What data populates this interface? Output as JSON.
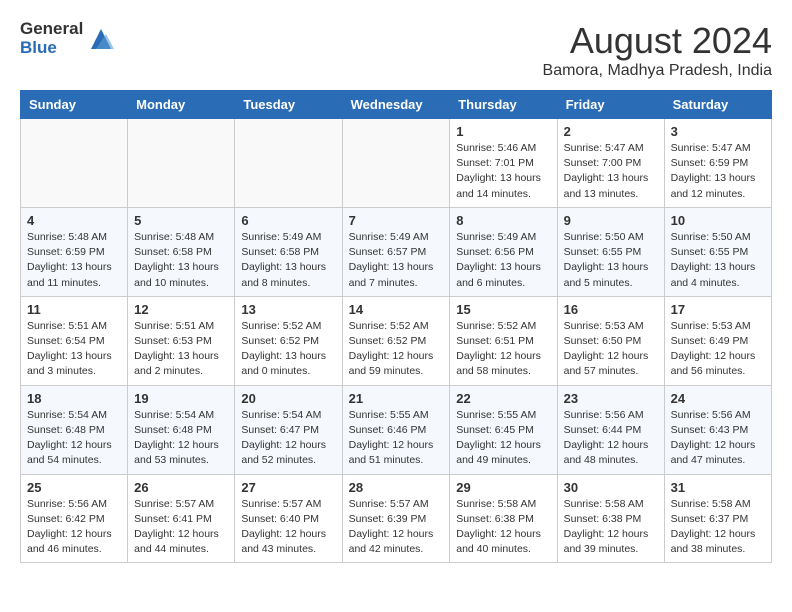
{
  "header": {
    "logo_line1": "General",
    "logo_line2": "Blue",
    "month_title": "August 2024",
    "location": "Bamora, Madhya Pradesh, India"
  },
  "weekdays": [
    "Sunday",
    "Monday",
    "Tuesday",
    "Wednesday",
    "Thursday",
    "Friday",
    "Saturday"
  ],
  "weeks": [
    [
      {
        "day": "",
        "info": ""
      },
      {
        "day": "",
        "info": ""
      },
      {
        "day": "",
        "info": ""
      },
      {
        "day": "",
        "info": ""
      },
      {
        "day": "1",
        "info": "Sunrise: 5:46 AM\nSunset: 7:01 PM\nDaylight: 13 hours\nand 14 minutes."
      },
      {
        "day": "2",
        "info": "Sunrise: 5:47 AM\nSunset: 7:00 PM\nDaylight: 13 hours\nand 13 minutes."
      },
      {
        "day": "3",
        "info": "Sunrise: 5:47 AM\nSunset: 6:59 PM\nDaylight: 13 hours\nand 12 minutes."
      }
    ],
    [
      {
        "day": "4",
        "info": "Sunrise: 5:48 AM\nSunset: 6:59 PM\nDaylight: 13 hours\nand 11 minutes."
      },
      {
        "day": "5",
        "info": "Sunrise: 5:48 AM\nSunset: 6:58 PM\nDaylight: 13 hours\nand 10 minutes."
      },
      {
        "day": "6",
        "info": "Sunrise: 5:49 AM\nSunset: 6:58 PM\nDaylight: 13 hours\nand 8 minutes."
      },
      {
        "day": "7",
        "info": "Sunrise: 5:49 AM\nSunset: 6:57 PM\nDaylight: 13 hours\nand 7 minutes."
      },
      {
        "day": "8",
        "info": "Sunrise: 5:49 AM\nSunset: 6:56 PM\nDaylight: 13 hours\nand 6 minutes."
      },
      {
        "day": "9",
        "info": "Sunrise: 5:50 AM\nSunset: 6:55 PM\nDaylight: 13 hours\nand 5 minutes."
      },
      {
        "day": "10",
        "info": "Sunrise: 5:50 AM\nSunset: 6:55 PM\nDaylight: 13 hours\nand 4 minutes."
      }
    ],
    [
      {
        "day": "11",
        "info": "Sunrise: 5:51 AM\nSunset: 6:54 PM\nDaylight: 13 hours\nand 3 minutes."
      },
      {
        "day": "12",
        "info": "Sunrise: 5:51 AM\nSunset: 6:53 PM\nDaylight: 13 hours\nand 2 minutes."
      },
      {
        "day": "13",
        "info": "Sunrise: 5:52 AM\nSunset: 6:52 PM\nDaylight: 13 hours\nand 0 minutes."
      },
      {
        "day": "14",
        "info": "Sunrise: 5:52 AM\nSunset: 6:52 PM\nDaylight: 12 hours\nand 59 minutes."
      },
      {
        "day": "15",
        "info": "Sunrise: 5:52 AM\nSunset: 6:51 PM\nDaylight: 12 hours\nand 58 minutes."
      },
      {
        "day": "16",
        "info": "Sunrise: 5:53 AM\nSunset: 6:50 PM\nDaylight: 12 hours\nand 57 minutes."
      },
      {
        "day": "17",
        "info": "Sunrise: 5:53 AM\nSunset: 6:49 PM\nDaylight: 12 hours\nand 56 minutes."
      }
    ],
    [
      {
        "day": "18",
        "info": "Sunrise: 5:54 AM\nSunset: 6:48 PM\nDaylight: 12 hours\nand 54 minutes."
      },
      {
        "day": "19",
        "info": "Sunrise: 5:54 AM\nSunset: 6:48 PM\nDaylight: 12 hours\nand 53 minutes."
      },
      {
        "day": "20",
        "info": "Sunrise: 5:54 AM\nSunset: 6:47 PM\nDaylight: 12 hours\nand 52 minutes."
      },
      {
        "day": "21",
        "info": "Sunrise: 5:55 AM\nSunset: 6:46 PM\nDaylight: 12 hours\nand 51 minutes."
      },
      {
        "day": "22",
        "info": "Sunrise: 5:55 AM\nSunset: 6:45 PM\nDaylight: 12 hours\nand 49 minutes."
      },
      {
        "day": "23",
        "info": "Sunrise: 5:56 AM\nSunset: 6:44 PM\nDaylight: 12 hours\nand 48 minutes."
      },
      {
        "day": "24",
        "info": "Sunrise: 5:56 AM\nSunset: 6:43 PM\nDaylight: 12 hours\nand 47 minutes."
      }
    ],
    [
      {
        "day": "25",
        "info": "Sunrise: 5:56 AM\nSunset: 6:42 PM\nDaylight: 12 hours\nand 46 minutes."
      },
      {
        "day": "26",
        "info": "Sunrise: 5:57 AM\nSunset: 6:41 PM\nDaylight: 12 hours\nand 44 minutes."
      },
      {
        "day": "27",
        "info": "Sunrise: 5:57 AM\nSunset: 6:40 PM\nDaylight: 12 hours\nand 43 minutes."
      },
      {
        "day": "28",
        "info": "Sunrise: 5:57 AM\nSunset: 6:39 PM\nDaylight: 12 hours\nand 42 minutes."
      },
      {
        "day": "29",
        "info": "Sunrise: 5:58 AM\nSunset: 6:38 PM\nDaylight: 12 hours\nand 40 minutes."
      },
      {
        "day": "30",
        "info": "Sunrise: 5:58 AM\nSunset: 6:38 PM\nDaylight: 12 hours\nand 39 minutes."
      },
      {
        "day": "31",
        "info": "Sunrise: 5:58 AM\nSunset: 6:37 PM\nDaylight: 12 hours\nand 38 minutes."
      }
    ]
  ]
}
